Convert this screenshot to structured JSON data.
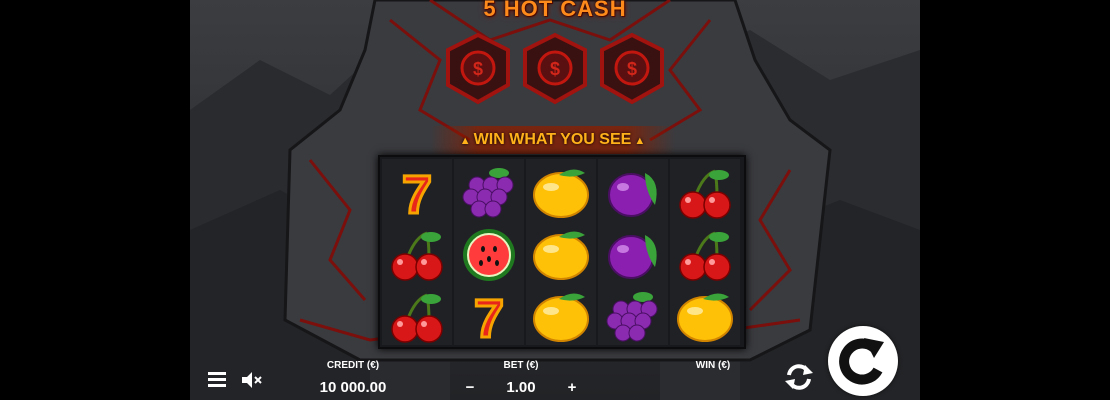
{
  "game": {
    "title": "5 HOT CASH",
    "banner": "WIN WHAT YOU SEE"
  },
  "reels": [
    [
      "seven",
      "cherry",
      "cherry"
    ],
    [
      "grapes",
      "watermelon",
      "seven"
    ],
    [
      "lemon",
      "lemon",
      "lemon"
    ],
    [
      "plum",
      "plum",
      "grapes"
    ],
    [
      "cherry",
      "cherry",
      "lemon"
    ]
  ],
  "hud": {
    "credit_label": "CREDIT (€)",
    "credit_value": "10 000.00",
    "bet_label": "BET (€)",
    "bet_value": "1.00",
    "bet_minus": "−",
    "bet_plus": "+",
    "win_label": "WIN (€)",
    "win_value": ""
  },
  "colors": {
    "title": "#ff8a1c",
    "accent_red": "#b8140e",
    "spin_button": "#ffffff"
  },
  "icons": [
    "menu-icon",
    "sound-muted-icon",
    "autoplay-icon",
    "spin-icon",
    "dollar-icon"
  ]
}
